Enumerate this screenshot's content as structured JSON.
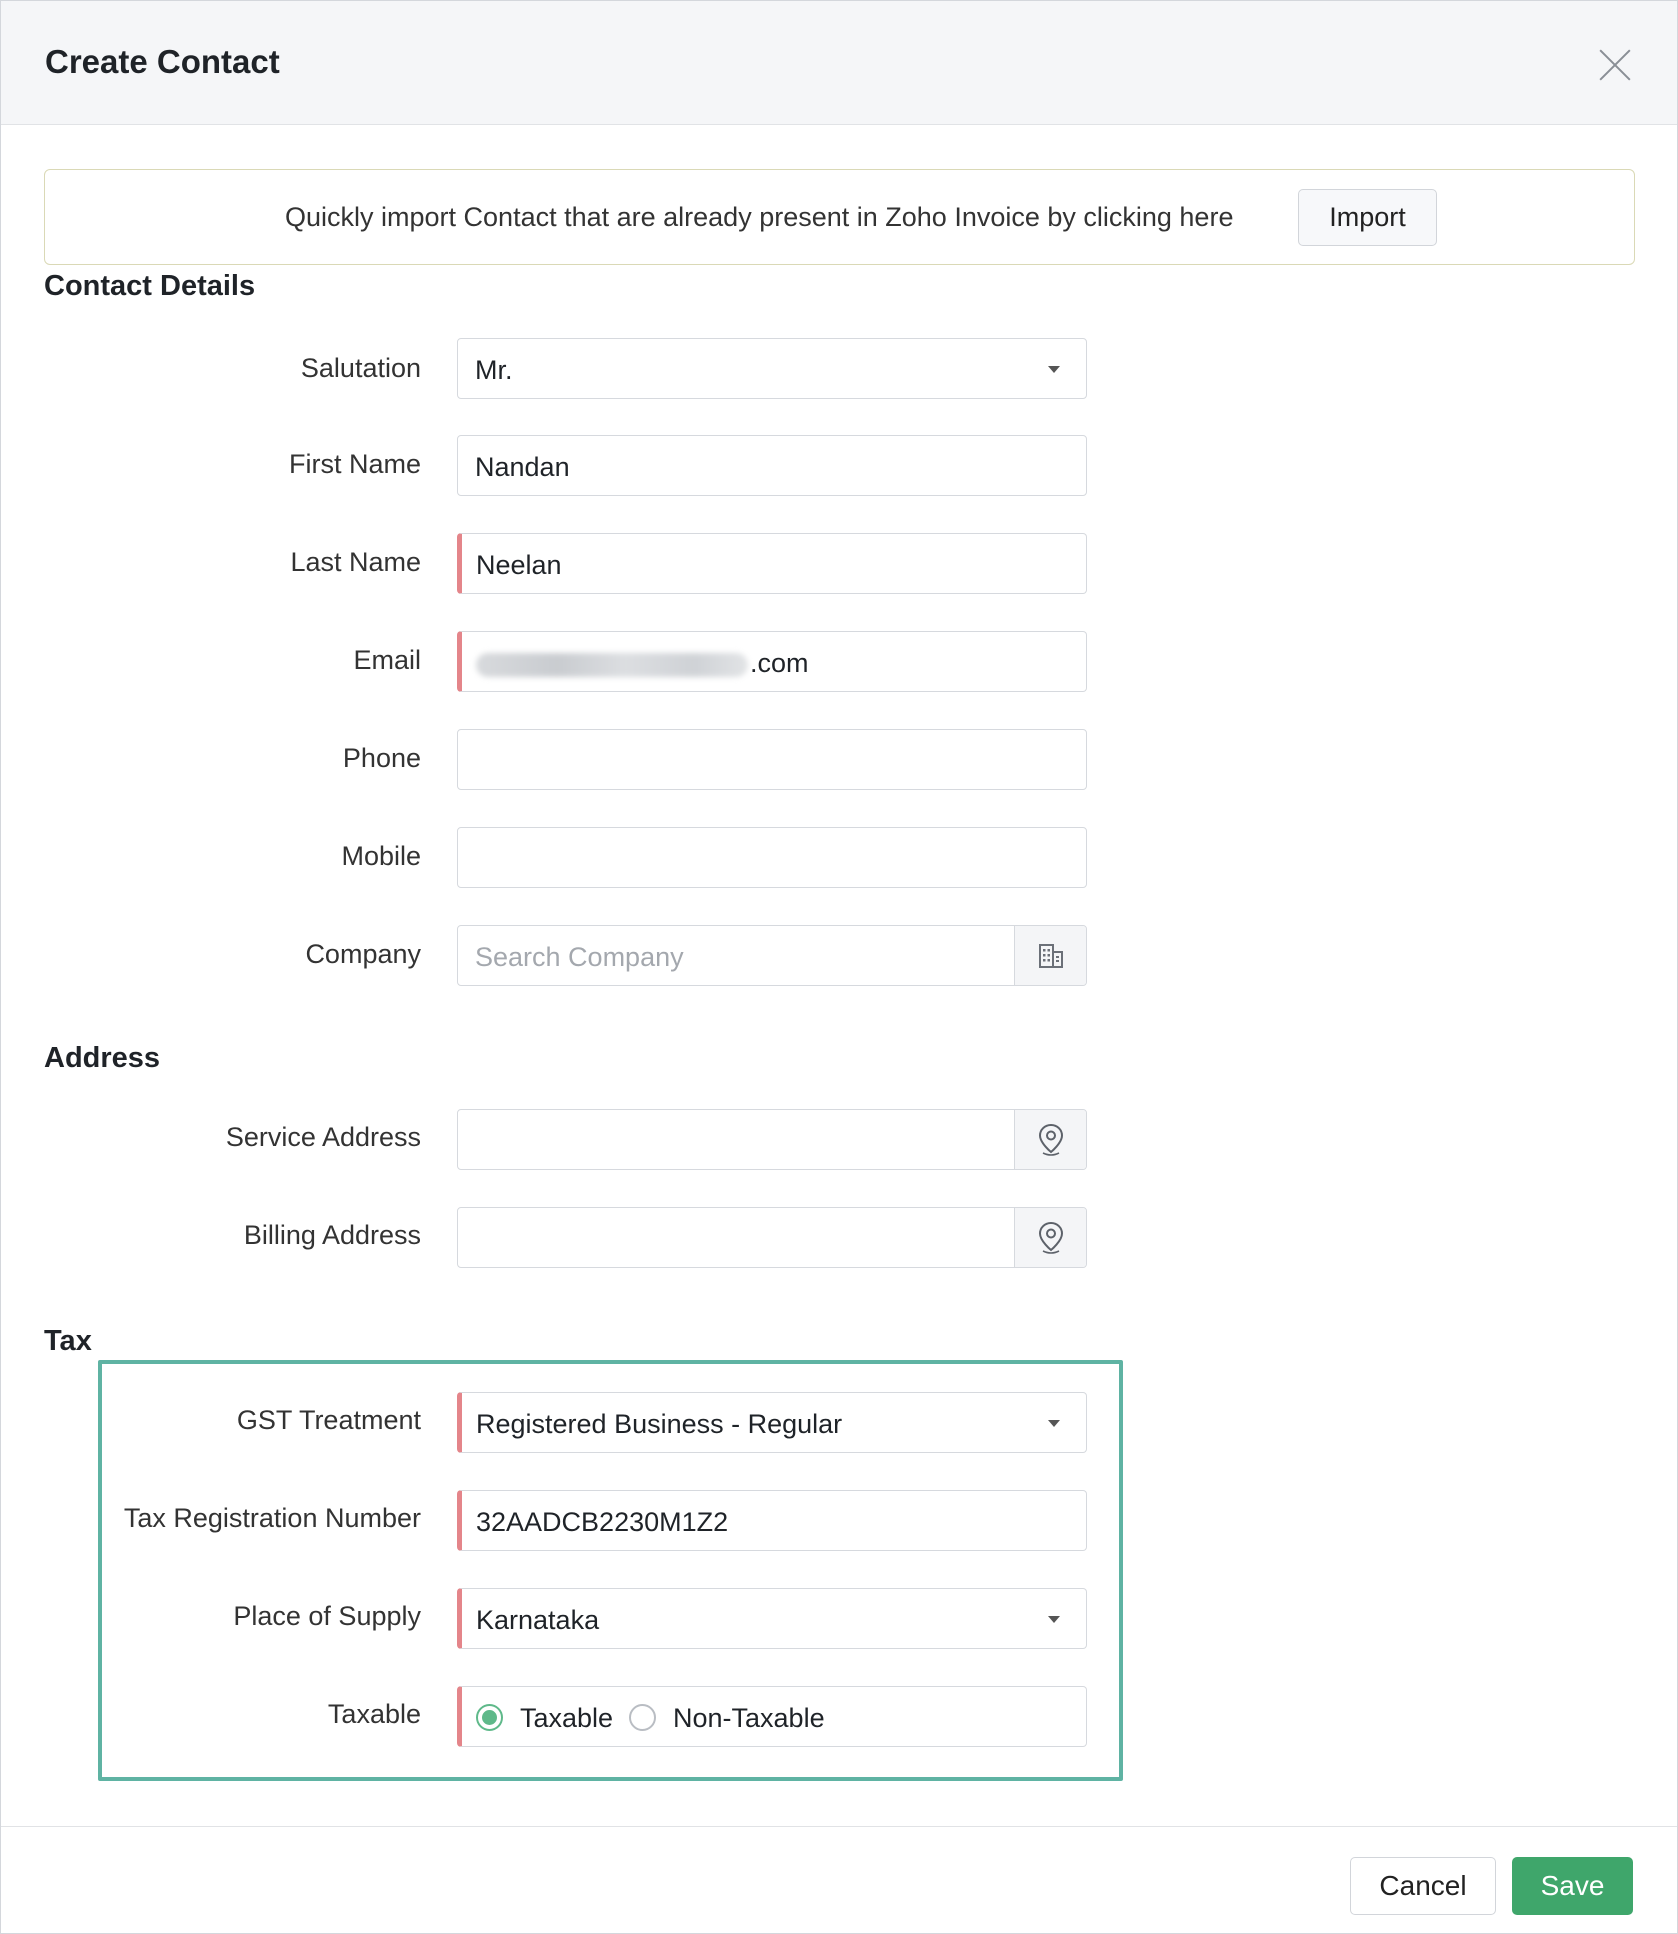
{
  "dialog": {
    "title": "Create Contact",
    "close_icon": "close-icon"
  },
  "import_banner": {
    "text": "Quickly import Contact that are already present in Zoho Invoice by clicking here",
    "button_label": "Import"
  },
  "sections": {
    "contact_details": "Contact Details",
    "address": "Address",
    "tax": "Tax"
  },
  "contact_details": {
    "salutation": {
      "label": "Salutation",
      "value": "Mr."
    },
    "first_name": {
      "label": "First Name",
      "value": "Nandan"
    },
    "last_name": {
      "label": "Last Name",
      "value": "Neelan"
    },
    "email": {
      "label": "Email",
      "value_visible_suffix": ".com"
    },
    "phone": {
      "label": "Phone",
      "value": ""
    },
    "mobile": {
      "label": "Mobile",
      "value": ""
    },
    "company": {
      "label": "Company",
      "placeholder": "Search Company",
      "icon": "building-icon"
    }
  },
  "address": {
    "service_address": {
      "label": "Service Address",
      "value": "",
      "icon": "map-pin-icon"
    },
    "billing_address": {
      "label": "Billing Address",
      "value": "",
      "icon": "map-pin-icon"
    }
  },
  "tax": {
    "gst_treatment": {
      "label": "GST Treatment",
      "value": "Registered Business - Regular"
    },
    "tax_registration_number": {
      "label": "Tax Registration Number",
      "value": "32AADCB2230M1Z2"
    },
    "place_of_supply": {
      "label": "Place of Supply",
      "value": "Karnataka"
    },
    "taxable": {
      "label": "Taxable",
      "options": [
        "Taxable",
        "Non-Taxable"
      ],
      "selected": "Taxable"
    }
  },
  "footer": {
    "cancel_label": "Cancel",
    "save_label": "Save"
  },
  "colors": {
    "required_marker": "#e4858a",
    "highlight_border": "#5fb3a3",
    "save_button": "#3fa66b",
    "radio_selected": "#5fb98a"
  }
}
